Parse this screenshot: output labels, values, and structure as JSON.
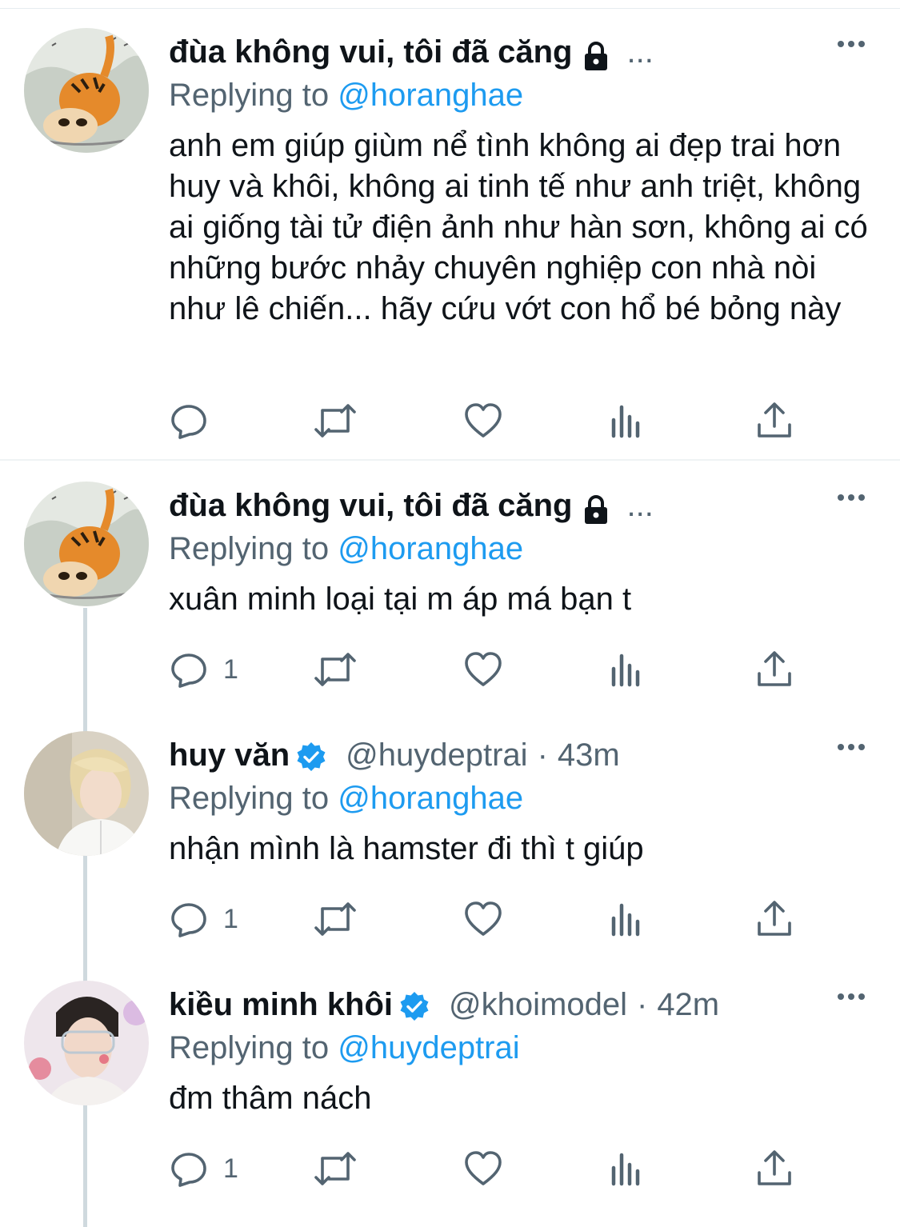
{
  "tweets": [
    {
      "author_name": "đùa không vui, tôi đã căng",
      "ellipsis": "...",
      "handle": "",
      "time": "",
      "replying_prefix": "Replying to ",
      "replying_to": "@horanghae",
      "text": "anh em giúp giùm nể tình không ai đẹp trai hơn huy và khôi, không ai tinh tế như anh triệt, không ai giống tài tử điện ảnh như hàn sơn, không ai có những bước nhảy chuyên nghiệp con nhà nòi như lê chiến... hãy cứu vớt con hổ bé bỏng này",
      "reply_count": "",
      "avatar": "tiger-illustration"
    },
    {
      "author_name": "đùa không vui, tôi đã căng",
      "ellipsis": "...",
      "handle": "",
      "time": "",
      "replying_prefix": "Replying to ",
      "replying_to": "@horanghae",
      "text": "xuân minh loại tại m áp má bạn t",
      "reply_count": "1",
      "avatar": "tiger-illustration"
    },
    {
      "author_name": "huy văn",
      "ellipsis": "",
      "handle": "@huydeptrai",
      "time": "43m",
      "replying_prefix": "Replying to ",
      "replying_to": "@horanghae",
      "text": "nhận mình là hamster đi thì t giúp",
      "reply_count": "1",
      "avatar": "person-blond-hair-photo"
    },
    {
      "author_name": "kiều minh khôi",
      "ellipsis": "",
      "handle": "@khoimodel",
      "time": "42m",
      "replying_prefix": "Replying to ",
      "replying_to": "@huydeptrai",
      "text": "đm thâm nách",
      "reply_count": "1",
      "avatar": "person-dark-hair-photo"
    }
  ],
  "separator_dot": "·",
  "colors": {
    "text": "#0f1419",
    "secondary": "#536471",
    "accent": "#1d9bf0",
    "thread_line": "#cfd9de",
    "divider": "#eff3f4"
  },
  "icons": {
    "lock": "lock-icon",
    "verified": "verified-badge-icon",
    "more": "more-options-icon",
    "reply": "reply-icon",
    "retweet": "retweet-icon",
    "like": "heart-icon",
    "analytics": "analytics-icon",
    "share": "share-icon"
  }
}
